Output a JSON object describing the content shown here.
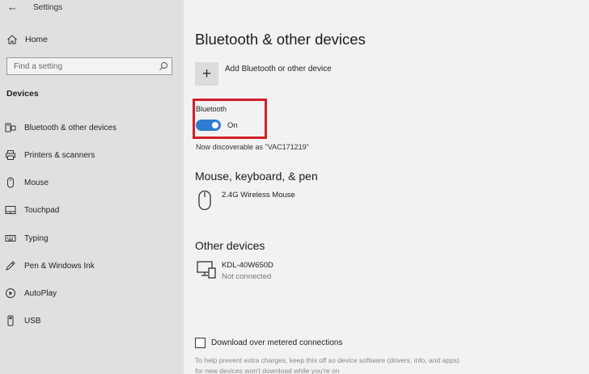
{
  "window": {
    "title": "Settings",
    "back_glyph": "←"
  },
  "sidebar": {
    "home_label": "Home",
    "search_placeholder": "Find a setting",
    "section_title": "Devices",
    "items": [
      {
        "label": "Bluetooth & other devices",
        "icon": "bluetooth-devices-icon"
      },
      {
        "label": "Printers & scanners",
        "icon": "printer-icon"
      },
      {
        "label": "Mouse",
        "icon": "mouse-icon"
      },
      {
        "label": "Touchpad",
        "icon": "touchpad-icon"
      },
      {
        "label": "Typing",
        "icon": "keyboard-icon"
      },
      {
        "label": "Pen & Windows Ink",
        "icon": "pen-icon"
      },
      {
        "label": "AutoPlay",
        "icon": "autoplay-icon"
      },
      {
        "label": "USB",
        "icon": "usb-icon"
      }
    ]
  },
  "main": {
    "title": "Bluetooth & other devices",
    "add_glyph": "+",
    "add_device_label": "Add Bluetooth or other device",
    "bluetooth": {
      "label": "Bluetooth",
      "state": "On",
      "discoverable_text": "Now discoverable as \"VAC171219\""
    },
    "mouse_section": {
      "title": "Mouse, keyboard, & pen",
      "devices": [
        {
          "name": "2.4G Wireless Mouse",
          "icon": "mouse-icon"
        }
      ]
    },
    "other_section": {
      "title": "Other devices",
      "devices": [
        {
          "name": "KDL-40W650D",
          "status": "Not connected",
          "icon": "display-device-icon"
        }
      ]
    },
    "metered": {
      "label": "Download over metered connections",
      "help": "To help prevent extra charges, keep this off so device software (drivers, info, and apps) for new devices won't download while you're on"
    }
  },
  "colors": {
    "accent": "#2f7bd0",
    "highlight_border": "#d11f2b",
    "sidebar_bg": "#e2dfe0",
    "content_bg": "#f2f2f2"
  }
}
